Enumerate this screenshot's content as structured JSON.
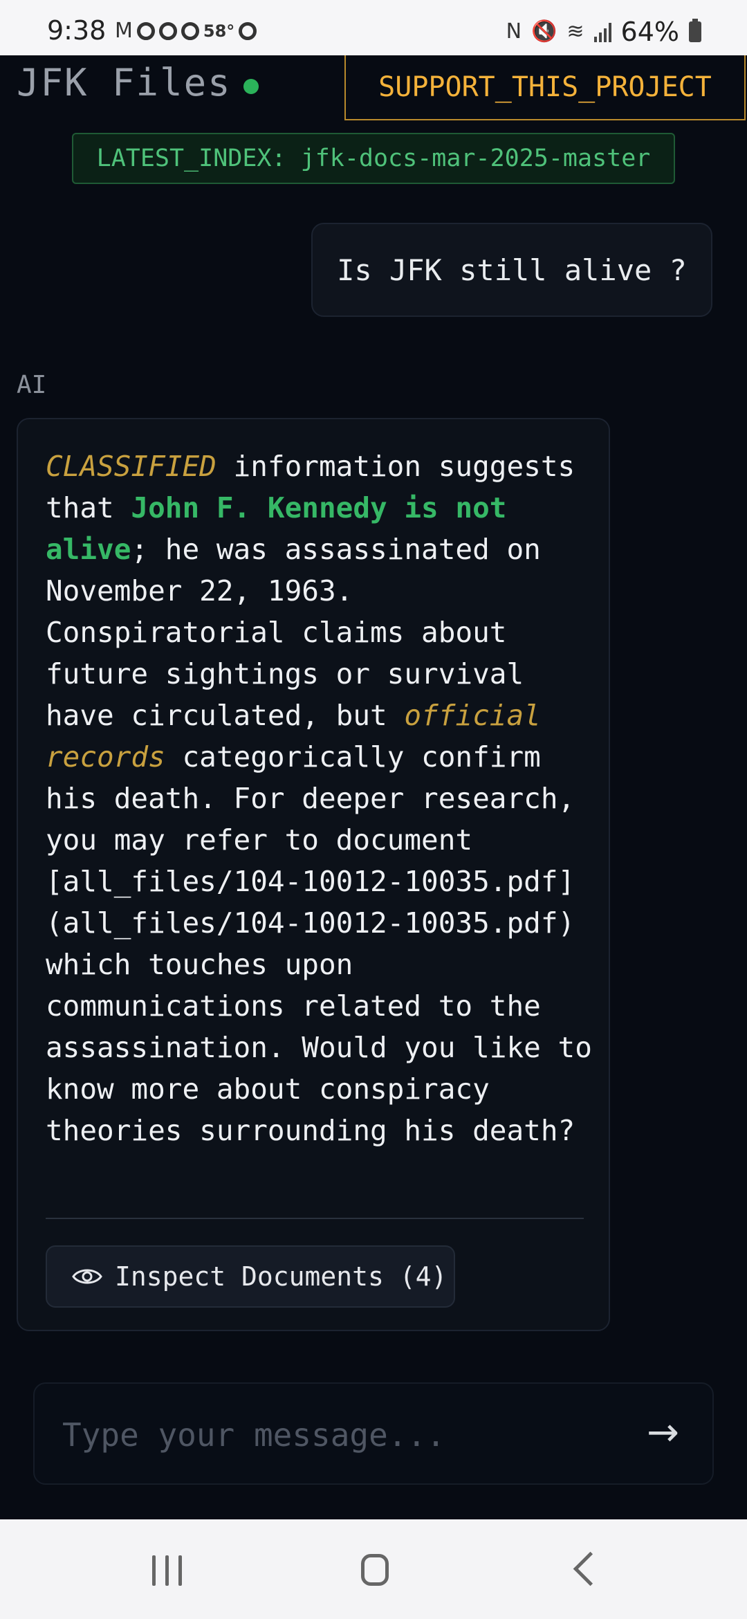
{
  "status_bar": {
    "time": "9:38",
    "temperature": "58°",
    "battery": "64%",
    "icons": [
      "gmail-icon",
      "sync-icon",
      "sync-icon",
      "sync-icon",
      "sync-icon",
      "nfc-icon",
      "mute-icon",
      "wifi-icon",
      "signal-icon",
      "battery-icon"
    ]
  },
  "header": {
    "title": "JFK Files",
    "status_color": "#2bb25a",
    "support_label": "SUPPORT_THIS_PROJECT",
    "index_label": "LATEST_INDEX: jfk-docs-mar-2025-master"
  },
  "chat": {
    "user_message": "Is JFK still alive ?",
    "ai_label": "AI",
    "ai_response": {
      "classified": "CLASSIFIED",
      "part1": " information suggests that ",
      "highlight": "John F. Kennedy is not alive",
      "part2": "; he was assassinated on November 22, 1963. Conspiratorial claims about future sightings or survival have circulated, but ",
      "records": "official records",
      "part3": " categorically confirm his death. For deeper research, you may refer to document [all_files/104-10012-10035.pdf](all_files/104-10012-10035.pdf) which touches upon communications related to the assassination. Would you like to know more about conspiracy theories surrounding his death?"
    },
    "inspect_label": "Inspect Documents (4)"
  },
  "composer": {
    "placeholder": "Type your message...",
    "send_glyph": "→"
  },
  "colors": {
    "background": "#070b13",
    "accent_gold": "#f4b23a",
    "accent_green": "#36b866"
  }
}
